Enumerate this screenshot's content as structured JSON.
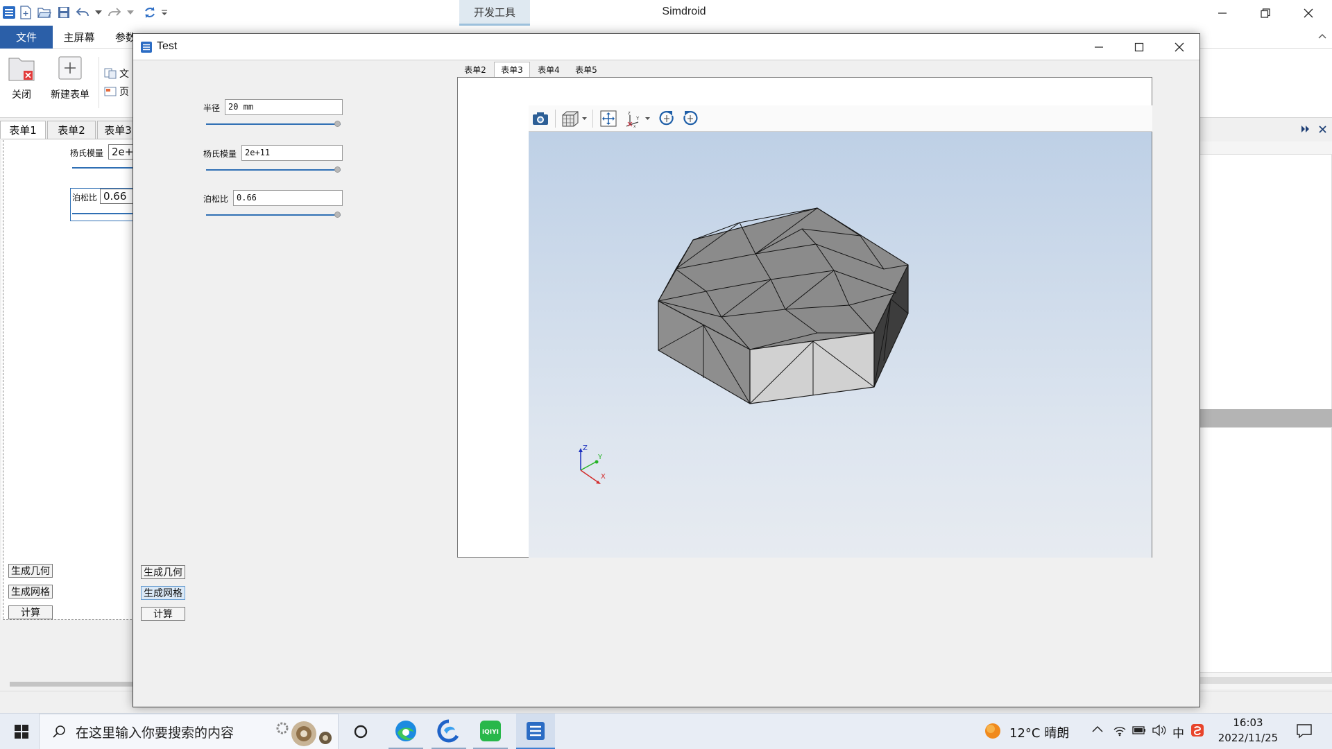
{
  "app": {
    "title": "Simdroid",
    "devtools_tab": "开发工具"
  },
  "menu": {
    "file": "文件",
    "main": "主屏幕",
    "params": "参数"
  },
  "ribbon": {
    "close": "关闭",
    "new_form": "新建表单",
    "doc_small": "文",
    "page_small": "页"
  },
  "editor": {
    "tabs": [
      "表单1",
      "表单2",
      "表单3"
    ],
    "young_label": "杨氏模量",
    "young_value": "2e+",
    "poisson_label": "泊松比",
    "poisson_value": "0.66",
    "btn_geometry": "生成几何",
    "btn_mesh": "生成网格",
    "btn_compute": "计算"
  },
  "test_window": {
    "title": "Test",
    "radius_label": "半径",
    "radius_value": "20 mm",
    "young_label": "杨氏模量",
    "young_value": "2e+11",
    "poisson_label": "泊松比",
    "poisson_value": "0.66",
    "btn_geometry": "生成几何",
    "btn_mesh": "生成网格",
    "btn_compute": "计算",
    "tabs": [
      "表单2",
      "表单3",
      "表单4",
      "表单5"
    ],
    "active_tab": "表单3",
    "axes": {
      "x": "X",
      "y": "Y",
      "z": "Z"
    }
  },
  "taskbar": {
    "search_placeholder": "在这里输入你要搜索的内容",
    "weather": "12°C 晴朗",
    "ime": "中",
    "time": "16:03",
    "date": "2022/11/25"
  },
  "colors": {
    "accent": "#2b5fa8",
    "slider": "#2f6fb4",
    "mesh_top": "#8a8a8a",
    "mesh_front": "#d2d2d2",
    "mesh_side": "#555555"
  }
}
